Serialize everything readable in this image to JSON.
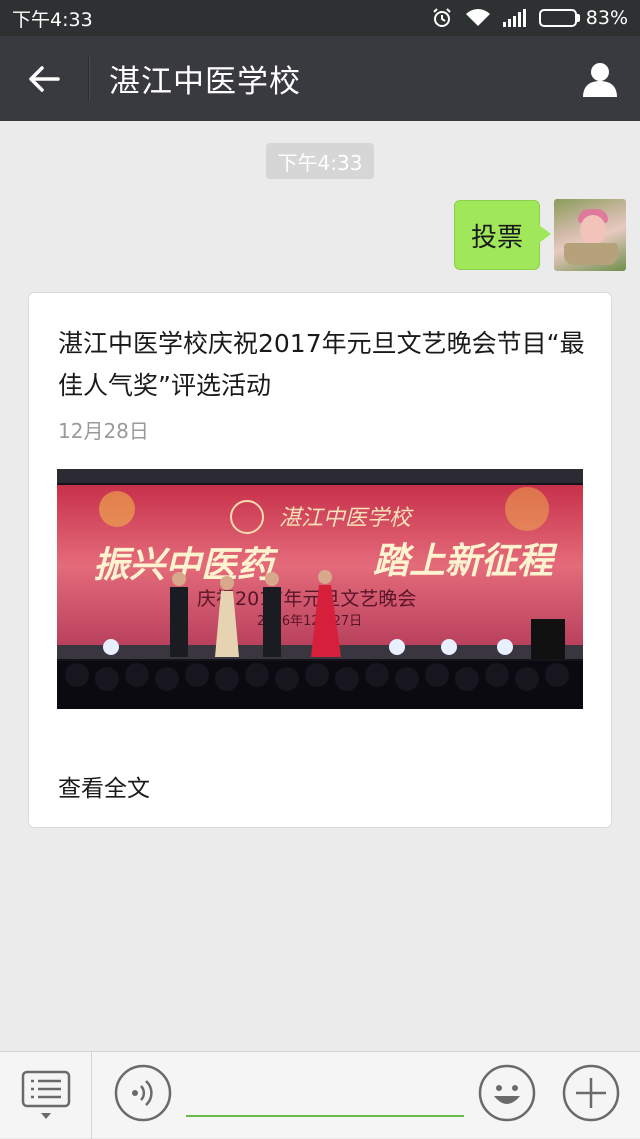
{
  "status_bar": {
    "time": "下午4:33",
    "battery": "83%"
  },
  "header": {
    "title": "湛江中医学校"
  },
  "chat": {
    "timestamp": "下午4:33",
    "sent_message": "投票",
    "article": {
      "title": "湛江中医学校庆祝2017年元旦文艺晚会节目“最佳人气奖”评选活动",
      "date": "12月28日",
      "image": {
        "school_name": "湛江中医学校",
        "slogan_left": "振兴中医药",
        "slogan_right": "踏上新征程",
        "event_line": "庆祝2017年元旦文艺晚会",
        "date_line": "2016年12月27日"
      },
      "read_more": "查看全文"
    }
  },
  "input_bar": {
    "placeholder": ""
  },
  "colors": {
    "accent_green": "#a0e759",
    "header_bg": "#393a3f",
    "input_underline": "#68bb4d"
  }
}
